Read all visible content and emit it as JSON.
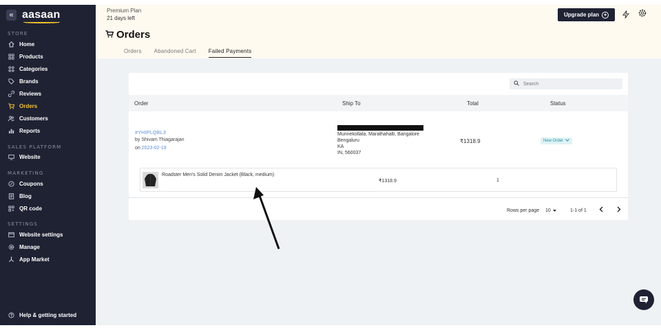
{
  "sidebar": {
    "brand": "aasaan",
    "collapse_glyph": "«",
    "sections": {
      "store": "STORE",
      "sales": "SALES PLATFORM",
      "marketing": "MARKETING",
      "settings": "SETTINGS"
    },
    "items": [
      {
        "label": "Home",
        "icon": "home-icon"
      },
      {
        "label": "Products",
        "icon": "grid-icon"
      },
      {
        "label": "Categories",
        "icon": "categories-icon"
      },
      {
        "label": "Brands",
        "icon": "tag-icon"
      },
      {
        "label": "Reviews",
        "icon": "link-icon"
      },
      {
        "label": "Orders",
        "icon": "cart-icon"
      },
      {
        "label": "Customers",
        "icon": "users-icon"
      },
      {
        "label": "Reports",
        "icon": "bar-chart-icon"
      },
      {
        "label": "Website",
        "icon": "monitor-icon"
      },
      {
        "label": "Coupons",
        "icon": "percent-icon"
      },
      {
        "label": "Blog",
        "icon": "blog-icon"
      },
      {
        "label": "QR code",
        "icon": "qr-icon"
      },
      {
        "label": "Website settings",
        "icon": "window-settings-icon"
      },
      {
        "label": "Manage",
        "icon": "gear-icon"
      },
      {
        "label": "App Market",
        "icon": "apps-icon"
      }
    ],
    "help": "Help & getting started"
  },
  "topbar": {
    "plan_name": "Premium Plan",
    "plan_days": "21 days left",
    "upgrade_label": "Upgrade plan"
  },
  "page": {
    "title": "Orders",
    "tabs": [
      "Orders",
      "Abandoned Cart",
      "Failed Payments"
    ],
    "active_tab": "Failed Payments"
  },
  "search": {
    "placeholder": "Search"
  },
  "table": {
    "headers": [
      "Order",
      "Ship To",
      "Total",
      "Status"
    ],
    "order": {
      "id": "#YHIPLQBL3",
      "by_prefix": "by",
      "customer": "Shivam Thiagarajan",
      "on_prefix": "on",
      "date": "2023-02-19",
      "address_lines": [
        "Munnekollala, Marathahalli, Bangalore",
        "Bengaluru",
        "KA",
        "IN, 560037"
      ],
      "total": "₹1318.9",
      "status": "New Order"
    },
    "item": {
      "name": "Roadster Men's Solid Denim Jacket (Black, medium)",
      "price": "₹1318.9",
      "qty": "1"
    }
  },
  "pagination": {
    "rows_label": "Rows per page",
    "rows_value": "10",
    "range": "1-1 of 1"
  },
  "colors": {
    "sidebar_bg": "#1f2233",
    "accent": "#f2c230",
    "banner_bg": "#fffaf0",
    "link": "#5a8bd8"
  }
}
